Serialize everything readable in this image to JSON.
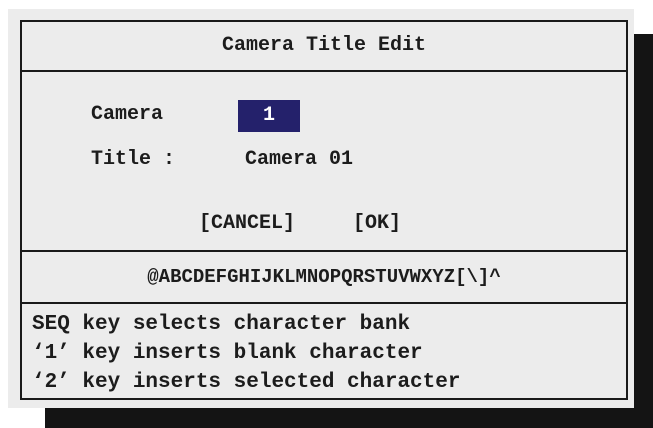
{
  "dialog": {
    "title": "Camera Title Edit",
    "camera_label": "Camera",
    "camera_value": "1",
    "title_label": "Title :",
    "title_value": "Camera 01",
    "cancel_label": "[CANCEL]",
    "ok_label": "[OK]",
    "character_bank": "@ABCDEFGHIJKLMNOPQRSTUVWXYZ[\\]^",
    "help_lines": [
      "SEQ key selects character bank",
      "‘1’ key inserts blank character",
      "‘2’ key inserts selected character"
    ]
  },
  "colors": {
    "panel_background": "#ececec",
    "selection_background": "#24216b",
    "selection_text": "#ffffff",
    "shadow": "#141414",
    "text": "#1c1c1c"
  }
}
